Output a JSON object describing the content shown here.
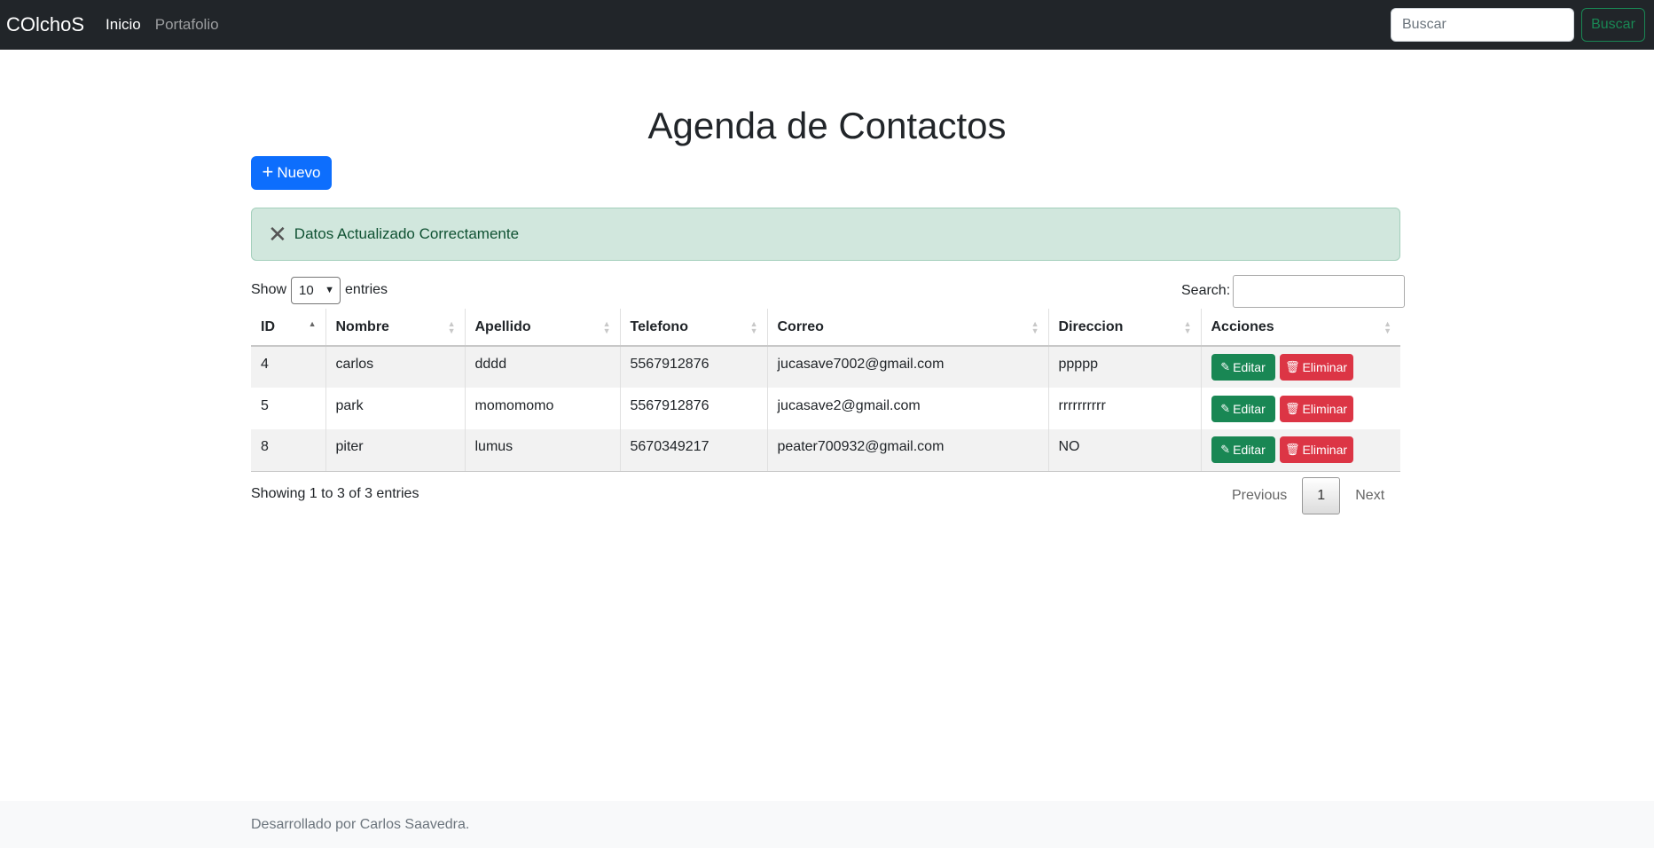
{
  "navbar": {
    "brand": "COlchoS",
    "links": [
      "Inicio",
      "Portafolio"
    ],
    "search_placeholder": "Buscar",
    "search_button": "Buscar"
  },
  "main": {
    "title": "Agenda de Contactos",
    "new_button": "Nuevo",
    "alert": "Datos Actualizado Correctamente",
    "length": {
      "show": "Show",
      "value": "10",
      "entries": "entries"
    },
    "search_label": "Search:",
    "columns": [
      "ID",
      "Nombre",
      "Apellido",
      "Telefono",
      "Correo",
      "Direccion",
      "Acciones"
    ],
    "rows": [
      {
        "id": "4",
        "nombre": "carlos",
        "apellido": "dddd",
        "telefono": "5567912876",
        "correo": "jucasave7002@gmail.com",
        "direccion": "ppppp"
      },
      {
        "id": "5",
        "nombre": "park",
        "apellido": "momomomo",
        "telefono": "5567912876",
        "correo": "jucasave2@gmail.com",
        "direccion": "rrrrrrrrrr"
      },
      {
        "id": "8",
        "nombre": "piter",
        "apellido": "lumus",
        "telefono": "5670349217",
        "correo": "peater700932@gmail.com",
        "direccion": "NO"
      }
    ],
    "edit_label": "Editar",
    "delete_label": "Eliminar",
    "info": "Showing 1 to 3 of 3 entries",
    "pager": {
      "previous": "Previous",
      "current": "1",
      "next": "Next"
    }
  },
  "footer": {
    "text": "Desarrollado por Carlos Saavedra."
  },
  "colors": {
    "navbar": "#212529",
    "primary": "#0d6efd",
    "success": "#198754",
    "danger": "#dc3545",
    "alert_bg": "#d1e7dd"
  }
}
